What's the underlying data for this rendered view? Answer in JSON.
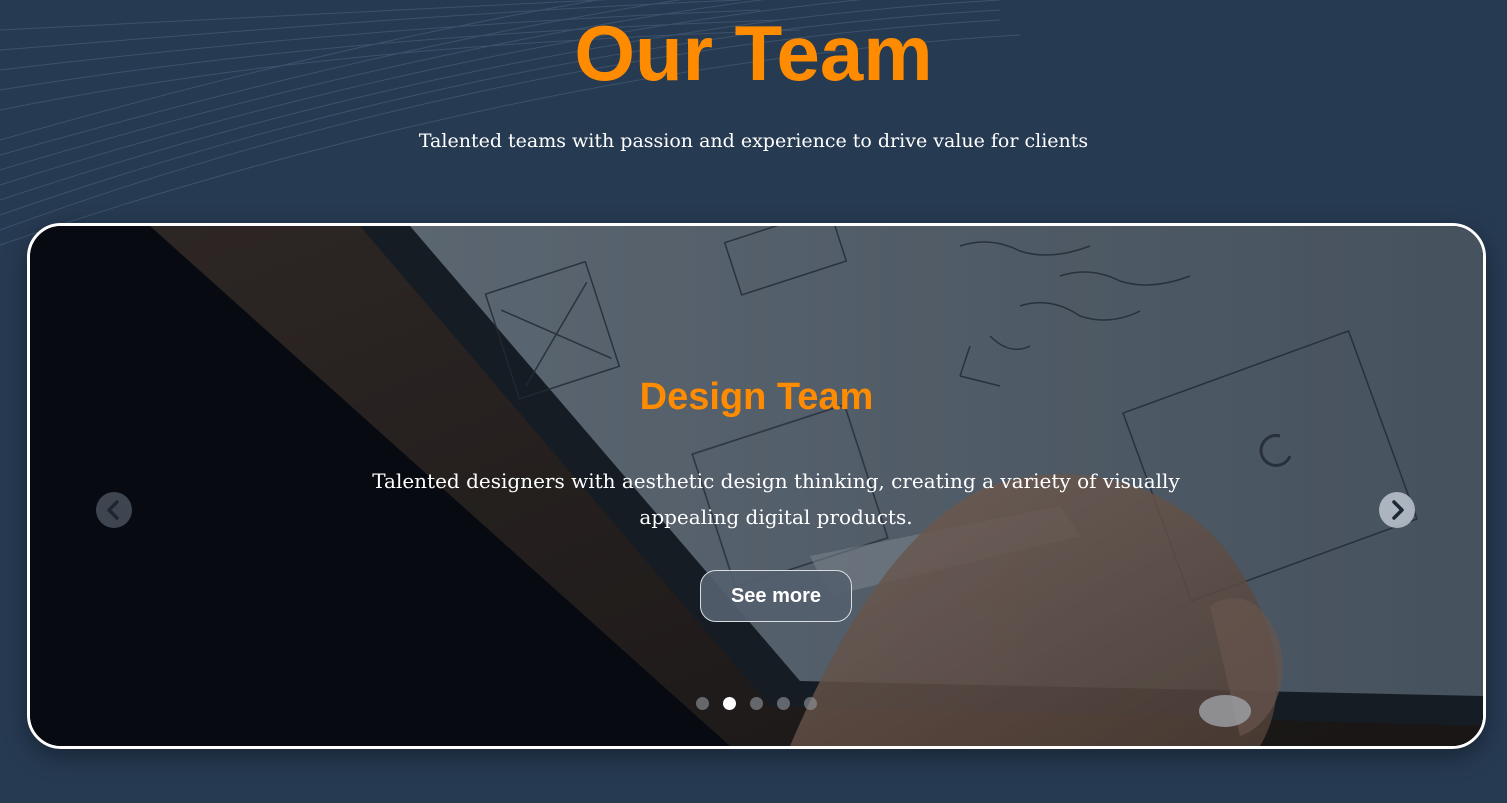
{
  "section": {
    "title": "Our Team",
    "subtitle": "Talented teams with passion and experience to drive value for clients"
  },
  "carousel": {
    "active_index": 1,
    "slide": {
      "title": "Design Team",
      "description": "Talented designers with aesthetic design thinking, creating a variety of visually appealing digital products.",
      "button_label": "See more",
      "image_icon": "tablet-sketch-image"
    },
    "dots_count": 5,
    "prev_icon": "chevron-left-icon",
    "next_icon": "chevron-right-icon"
  },
  "colors": {
    "background": "#263a52",
    "accent": "#ff8c00",
    "text": "#ffffff"
  }
}
